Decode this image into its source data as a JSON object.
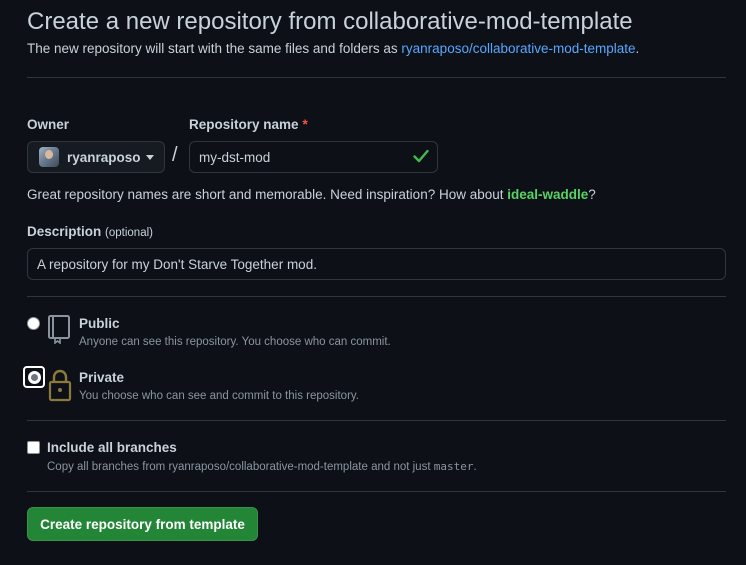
{
  "header": {
    "title": "Create a new repository from collaborative-mod-template",
    "subtitle_prefix": "The new repository will start with the same files and folders as ",
    "template_link": "ryanraposo/collaborative-mod-template",
    "subtitle_suffix": "."
  },
  "owner": {
    "label": "Owner",
    "value": "ryanraposo"
  },
  "repo_name": {
    "label": "Repository name",
    "required_mark": "*",
    "value": "my-dst-mod",
    "separator": "/"
  },
  "hint": {
    "prefix": "Great repository names are short and memorable. Need inspiration? How about ",
    "suggestion": "ideal-waddle",
    "suffix": "?"
  },
  "description": {
    "label": "Description",
    "optional": "(optional)",
    "value": "A repository for my Don't Starve Together mod."
  },
  "visibility": {
    "public": {
      "title": "Public",
      "desc": "Anyone can see this repository. You choose who can commit.",
      "selected": false
    },
    "private": {
      "title": "Private",
      "desc": "You choose who can see and commit to this repository.",
      "selected": true
    }
  },
  "branches": {
    "label": "Include all branches",
    "desc_prefix": "Copy all branches from ryanraposo/collaborative-mod-template and not just ",
    "desc_code": "master",
    "desc_suffix": ".",
    "checked": false
  },
  "submit": {
    "label": "Create repository from template"
  },
  "colors": {
    "background": "#0d1117",
    "link": "#58a6ff",
    "suggestion": "#56d364",
    "primary_button": "#238636",
    "required": "#f85149",
    "border": "#30363d"
  }
}
